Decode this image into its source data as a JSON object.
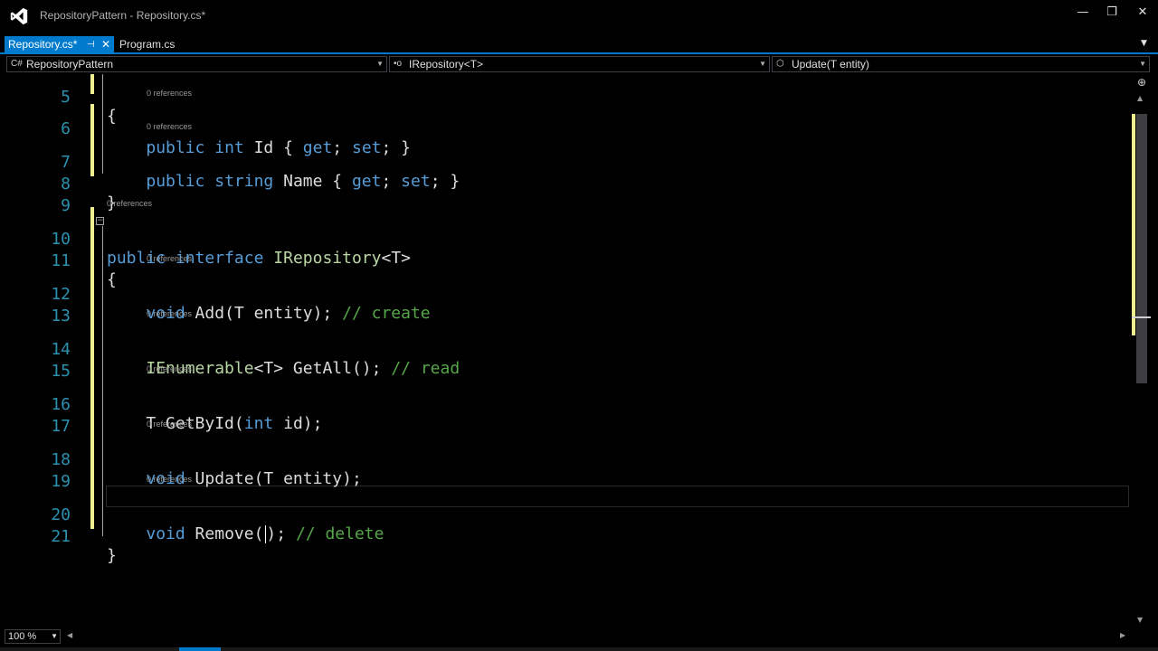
{
  "window": {
    "title": "RepositoryPattern - Repository.cs*",
    "minimize": "—",
    "maximize": "❐",
    "close": "✕",
    "logo_icon": "visual-studio-logo"
  },
  "tabs": [
    {
      "label": "Repository.cs*",
      "active": true,
      "pin": "⊣",
      "close": "✕"
    },
    {
      "label": "Program.cs",
      "active": false
    }
  ],
  "tab_dropdown": "▼",
  "navbar": {
    "project": {
      "icon": "C#",
      "label": "RepositoryPattern"
    },
    "type": {
      "icon": "•o",
      "label": "IRepository<T>"
    },
    "member": {
      "icon": "⬡",
      "label": "Update(T entity)"
    },
    "dropdown": "▼"
  },
  "code_lens": "0 references",
  "lines": {
    "l5": {
      "num": "5"
    },
    "l6": {
      "num": "6"
    },
    "l7": {
      "num": "7"
    },
    "l8": {
      "num": "8"
    },
    "l9": {
      "num": "9"
    },
    "l10": {
      "num": "10"
    },
    "l11": {
      "num": "11"
    },
    "l12": {
      "num": "12"
    },
    "l13": {
      "num": "13"
    },
    "l14": {
      "num": "14"
    },
    "l15": {
      "num": "15"
    },
    "l16": {
      "num": "16"
    },
    "l17": {
      "num": "17"
    },
    "l18": {
      "num": "18"
    },
    "l19": {
      "num": "19"
    },
    "l20": {
      "num": "20"
    },
    "l21": {
      "num": "21"
    }
  },
  "tokens": {
    "open_brace": "{",
    "close_brace": "}",
    "public": "public",
    "int": "int",
    "string": "string",
    "interface": "interface",
    "void": "void",
    "id_prop": " Id { ",
    "name_prop": " Name { ",
    "get": "get",
    "semi_space": "; ",
    "set": "set",
    "semi_close": "; }",
    "irepository": "IRepository",
    "generic_t": "<T>",
    "add_sig": " Add(T entity); ",
    "comment_create": "// create",
    "ienumerable": "IEnumerable",
    "getall_sig": " GetAll(); ",
    "comment_read": "// read",
    "t": "T",
    "getbyid_open": " GetById(",
    "getbyid_close": " id);",
    "update_sig": " Update(T entity);",
    "remove_open": " Remove(",
    "remove_close": "); ",
    "comment_delete": "// delete"
  },
  "collapse_glyph": "⊟",
  "scrollbar": {
    "split": "⊕",
    "up": "▲",
    "down": "▼"
  },
  "zoom": {
    "value": "100 %",
    "dropdown": "▼"
  },
  "hscroll": {
    "left": "◀",
    "right": "▶"
  }
}
